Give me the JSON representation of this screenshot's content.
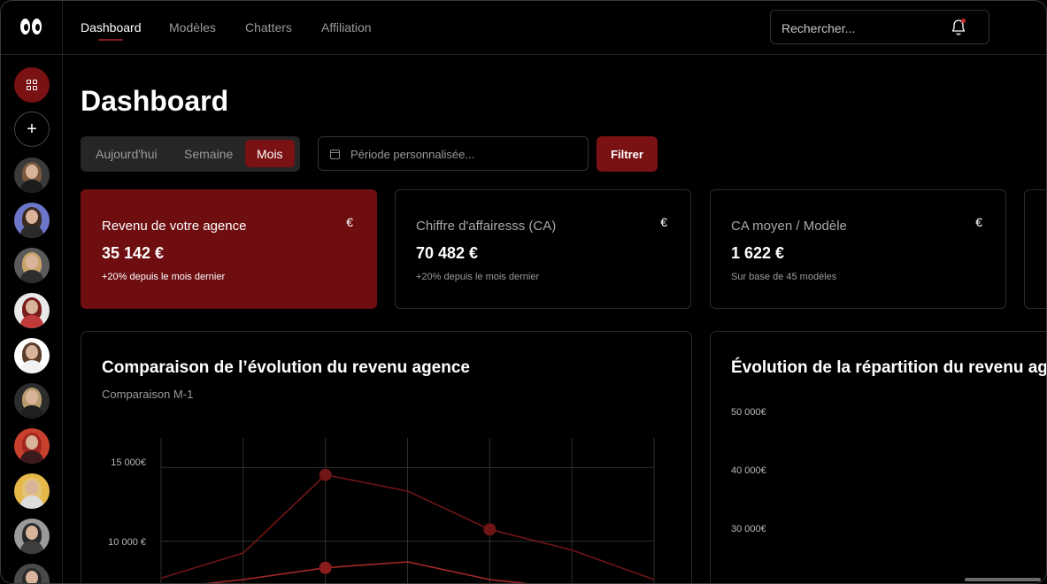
{
  "nav": {
    "tabs": [
      "Dashboard",
      "Modèles",
      "Chatters",
      "Affiliation"
    ],
    "active_tab": "Dashboard",
    "search_placeholder": "Rechercher..."
  },
  "sidebar": {
    "items": [
      {
        "icon": "dashboard-grid-icon",
        "active": true
      },
      {
        "icon": "plus-icon",
        "active": false
      }
    ],
    "avatars": [
      {
        "hair": "#7a5a3f",
        "body": "#1c1c1c",
        "bg": "#3a3a3a"
      },
      {
        "hair": "#3b2a1f",
        "body": "#2a2a2a",
        "bg": "#6b76c9"
      },
      {
        "hair": "#c9a36b",
        "body": "#2d2d2d",
        "bg": "#5a5a5a"
      },
      {
        "hair": "#7a1d1d",
        "body": "#c0393b",
        "bg": "#e9e9e9"
      },
      {
        "hair": "#5a3d2a",
        "body": "#f1f1f1",
        "bg": "#ffffff"
      },
      {
        "hair": "#b79a6e",
        "body": "#1f1f1f",
        "bg": "#2c2c2c"
      },
      {
        "hair": "#a4281f",
        "body": "#3a1a1a",
        "bg": "#c8412e"
      },
      {
        "hair": "#e3c27a",
        "body": "#dcdcdc",
        "bg": "#e6b84a"
      },
      {
        "hair": "#2a2a2a",
        "body": "#3d3d3d",
        "bg": "#9a9a9a"
      },
      {
        "hair": "#2a2a2a",
        "body": "#1a1a1a",
        "bg": "#4a4a4a"
      }
    ]
  },
  "page": {
    "title": "Dashboard",
    "period_tabs": [
      "Aujourd'hui",
      "Semaine",
      "Mois"
    ],
    "active_period": "Mois",
    "date_placeholder": "Période personnalisée...",
    "filter_label": "Filtrer"
  },
  "cards": [
    {
      "title": "Revenu de votre agence",
      "currency": "€",
      "value": "35 142 €",
      "sub": "+20% depuis le mois dernier"
    },
    {
      "title": "Chiffre d'affairesss (CA)",
      "currency": "€",
      "value": "70 482 €",
      "sub": "+20% depuis le mois dernier"
    },
    {
      "title": "CA moyen / Modèle",
      "currency": "€",
      "value": "1 622 €",
      "sub": "Sur base de 45 modèles"
    }
  ],
  "panels": {
    "left": {
      "title": "Comparaison de l’évolution du revenu agence",
      "subtitle": "Comparaison M-1"
    },
    "right": {
      "title": "Évolution de la répartition du revenu agence",
      "y_ticks": [
        "50 000€",
        "40 000€",
        "30 000€"
      ]
    }
  },
  "chart_data": {
    "type": "line",
    "x": [
      1,
      2,
      3,
      4,
      5,
      6,
      7
    ],
    "ylim": [
      7500,
      17000
    ],
    "y_ticks": [
      "15 000€",
      "10 000 €"
    ],
    "grid": true,
    "series": [
      {
        "values": [
          7500,
          9200,
          14500,
          13400,
          10800,
          9400,
          7400
        ],
        "color": "#6f1516"
      },
      {
        "values": [
          6800,
          7400,
          8200,
          8600,
          7400,
          6800,
          6600
        ],
        "color": "#a3282a"
      }
    ]
  }
}
